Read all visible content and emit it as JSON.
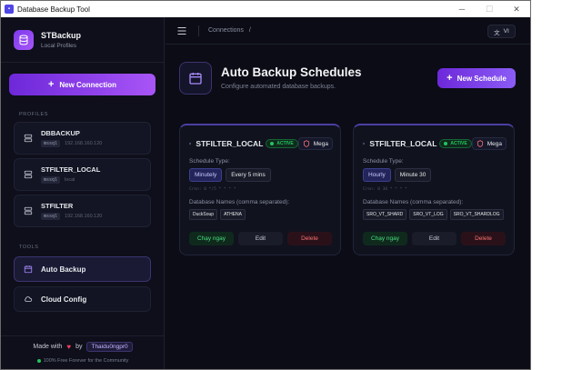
{
  "window": {
    "title": "Database Backup Tool"
  },
  "brand": {
    "name": "STBackup",
    "subtitle": "Local Profiles"
  },
  "sidebar": {
    "new_connection_label": "New Connection",
    "profiles_label": "PROFILES",
    "profiles": [
      {
        "name": "DBBACKUP",
        "type": "mssql",
        "host": "192.168.160.120"
      },
      {
        "name": "STFILTER_LOCAL",
        "type": "mssql",
        "host": "local"
      },
      {
        "name": "STFILTER",
        "type": "mssql",
        "host": "192.168.160.120"
      }
    ],
    "tools_label": "TOOLS",
    "tools": [
      {
        "label": "Auto Backup",
        "active": true
      },
      {
        "label": "Cloud Config",
        "active": false
      }
    ],
    "footer": {
      "made_with": "Made with",
      "by": "by",
      "author": "Thaidu0ngpr0",
      "free_text": "100% Free Forever for the Community"
    }
  },
  "topbar": {
    "breadcrumb": "Connections",
    "separator": "/",
    "language": "VI"
  },
  "page": {
    "title": "Auto Backup Schedules",
    "subtitle": "Configure automated database backups.",
    "new_schedule_label": "New Schedule"
  },
  "schedules": [
    {
      "name": "STFILTER_LOCAL",
      "status": "ACTIVE",
      "cloud": "Mega",
      "schedule_type_label": "Schedule Type:",
      "type": "Minutely",
      "interval": "Every 5 mins",
      "cron": "Cron: 0 */5 * * * *",
      "databases_label": "Database Names (comma separated):",
      "databases": [
        "DuckSoup",
        "ATHENA"
      ],
      "run_label": "Chạy ngay",
      "edit_label": "Edit",
      "delete_label": "Delete"
    },
    {
      "name": "STFILTER_LOCAL",
      "status": "ACTIVE",
      "cloud": "Mega",
      "schedule_type_label": "Schedule Type:",
      "type": "Hourly",
      "interval": "Minute 30",
      "cron": "Cron: 0 30 * * * *",
      "databases_label": "Database Names (comma separated):",
      "databases": [
        "SRO_VT_SHARD",
        "SRO_VT_LOG",
        "SRO_VT_SHARDLOG"
      ],
      "run_label": "Chạy ngay",
      "edit_label": "Edit",
      "delete_label": "Delete"
    }
  ],
  "colors": {
    "accent": "#7c3aed",
    "active_green": "#22c55e",
    "delete_red": "#f87171",
    "background": "#0b0c15"
  }
}
